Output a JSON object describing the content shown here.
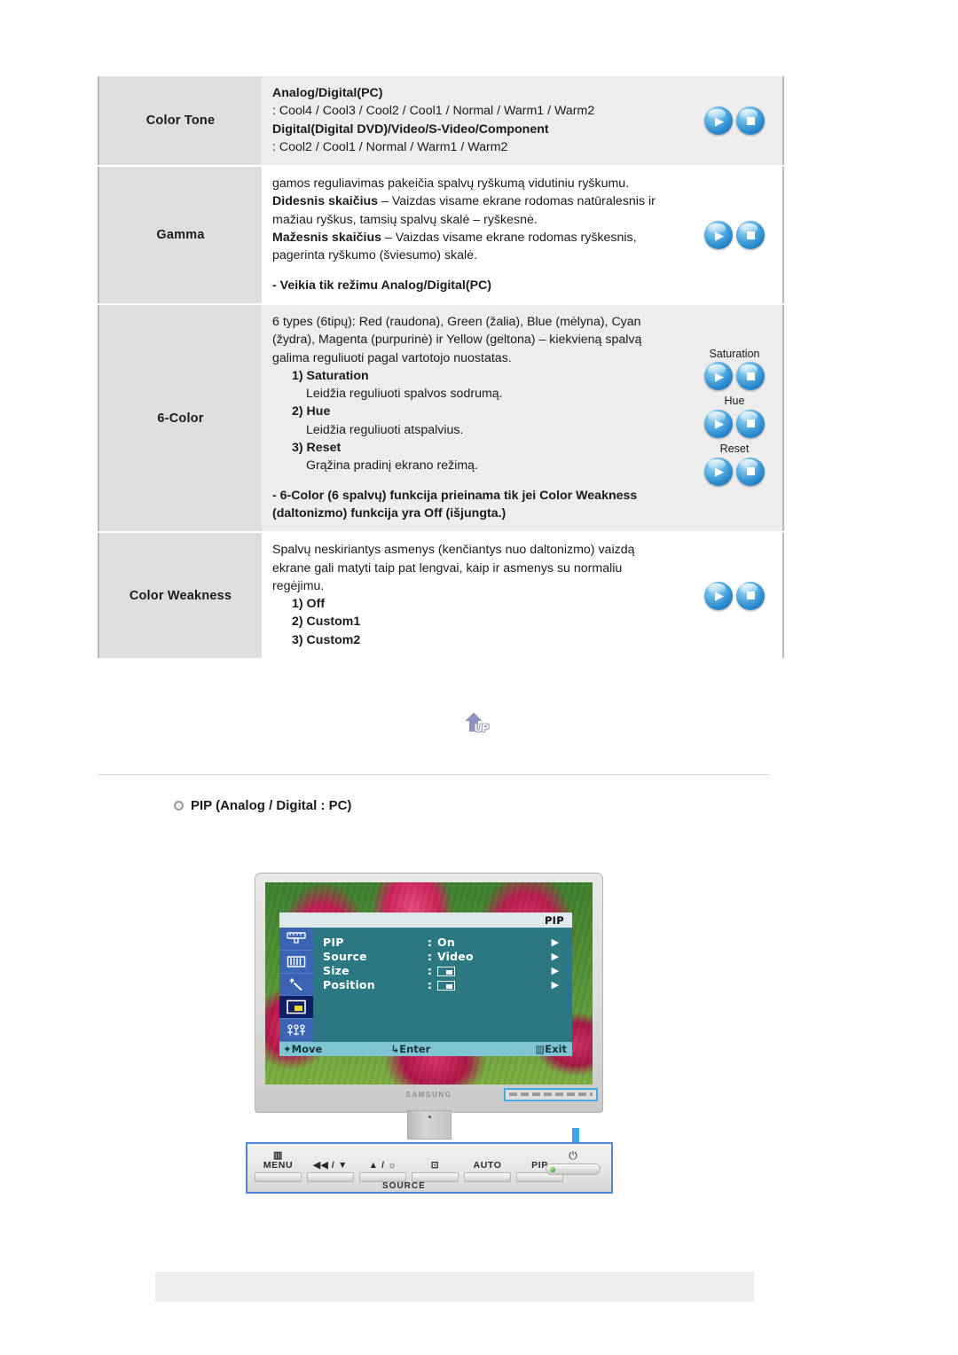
{
  "table": {
    "rows": [
      {
        "label": "Color Tone",
        "blocks": [
          {
            "type": "bold",
            "text": "Analog/Digital(PC)"
          },
          {
            "type": "plain",
            "text": ": Cool4 / Cool3 / Cool2 / Cool1 / Normal / Warm1 / Warm2"
          },
          {
            "type": "bold",
            "text": "Digital(Digital DVD)/Video/S-Video/Component"
          },
          {
            "type": "plain",
            "text": ": Cool2 / Cool1 / Normal / Warm1 / Warm2"
          }
        ],
        "icons": [
          {
            "label": "",
            "buttons": [
              "play-icon",
              "enter-icon"
            ]
          }
        ]
      },
      {
        "label": "Gamma",
        "blocks": [
          {
            "type": "plain",
            "text": "gamos reguliavimas pakeičia spalvų ryškumą vidutiniu ryškumu."
          },
          {
            "type": "mixed",
            "bold": "Didesnis skaičius",
            "rest": " – Vaizdas visame ekrane rodomas natūralesnis ir mažiau ryškus, tamsių spalvų skalė – ryškesnė."
          },
          {
            "type": "mixed",
            "bold": "Mažesnis skaičius",
            "rest": " – Vaizdas visame ekrane rodomas ryškesnis, pagerinta ryškumo (šviesumo) skalė."
          },
          {
            "type": "gap"
          },
          {
            "type": "bold",
            "text": "- Veikia tik režimu Analog/Digital(PC)"
          }
        ],
        "icons": [
          {
            "label": "",
            "buttons": [
              "play-icon",
              "enter-icon"
            ]
          }
        ]
      },
      {
        "label": "6-Color",
        "blocks": [
          {
            "type": "plain",
            "text": "6 types (6tipų): Red (raudona), Green (žalia), Blue (mėlyna), Cyan (žydra), Magenta (purpurinė) ir Yellow (geltona) – kiekvieną spalvą galima reguliuoti pagal vartotojo nuostatas."
          },
          {
            "type": "bold-indent",
            "text": "1) Saturation"
          },
          {
            "type": "plain-indent2",
            "text": "Leidžia reguliuoti spalvos sodrumą."
          },
          {
            "type": "bold-indent",
            "text": "2) Hue"
          },
          {
            "type": "plain-indent2",
            "text": "Leidžia reguliuoti atspalvius."
          },
          {
            "type": "bold-indent",
            "text": "3) Reset"
          },
          {
            "type": "plain-indent2",
            "text": "Grąžina pradinį ekrano režimą."
          },
          {
            "type": "gap"
          },
          {
            "type": "bold",
            "text": "- 6-Color (6 spalvų) funkcija prieinama tik jei Color Weakness (daltonizmo) funkcija yra Off (išjungta.)"
          }
        ],
        "icons": [
          {
            "label": "Saturation",
            "buttons": [
              "play-icon",
              "enter-icon"
            ]
          },
          {
            "label": "Hue",
            "buttons": [
              "play-icon",
              "enter-icon"
            ]
          },
          {
            "label": "Reset",
            "buttons": [
              "play-icon",
              "enter-icon"
            ]
          }
        ]
      },
      {
        "label": "Color Weakness",
        "blocks": [
          {
            "type": "plain",
            "text": "Spalvų neskiriantys asmenys (kenčiantys nuo daltonizmo) vaizdą ekrane gali matyti taip pat lengvai, kaip ir asmenys su normaliu regėjimu."
          },
          {
            "type": "bold-indent",
            "text": "1) Off"
          },
          {
            "type": "bold-indent",
            "text": "2) Custom1"
          },
          {
            "type": "bold-indent",
            "text": "3) Custom2"
          }
        ],
        "icons": [
          {
            "label": "",
            "buttons": [
              "play-icon",
              "enter-icon"
            ]
          }
        ]
      }
    ]
  },
  "up_button": {
    "label": "UP"
  },
  "section": {
    "pip_heading": "PIP (Analog / Digital : PC)"
  },
  "osd": {
    "title": "PIP",
    "rows": [
      {
        "name": "PIP",
        "colon": ":",
        "value": "On",
        "value_type": "text",
        "arrow": "▶"
      },
      {
        "name": "Source",
        "colon": ":",
        "value": "Video",
        "value_type": "text",
        "arrow": "▶"
      },
      {
        "name": "Size",
        "colon": ":",
        "value": "",
        "value_type": "box",
        "arrow": "▶"
      },
      {
        "name": "Position",
        "colon": ":",
        "value": "",
        "value_type": "box",
        "arrow": "▶"
      }
    ],
    "footer": {
      "move": "Move",
      "enter": "Enter",
      "exit": "Exit"
    },
    "sidebar_icons": [
      "brightness-contrast-icon",
      "color-bars-icon",
      "image-magic-icon",
      "pip-icon",
      "setup-icon"
    ]
  },
  "monitor": {
    "brand": "SAMSUNG"
  },
  "control_panel": {
    "buttons": [
      {
        "glyph": "▥",
        "label": "MENU"
      },
      {
        "glyph": "",
        "label": "◀◀ / ▼"
      },
      {
        "glyph": "",
        "label": "▲ / ☼"
      },
      {
        "glyph": "⊡",
        "label": ""
      },
      {
        "glyph": "",
        "label": "AUTO"
      },
      {
        "glyph": "",
        "label": "PIP"
      }
    ],
    "source_label": "SOURCE",
    "power_glyph": "⏻"
  },
  "colors": {
    "table_label_bg": "#dedede",
    "table_desc_bg": "#ededed",
    "osd_body": "#2c7882",
    "osd_sidebar": "#3b64b4",
    "osd_selected": "#101f63",
    "osd_footer": "#7fc4d3",
    "osd_title_bar": "#dfe9ec",
    "accent_blue": "#4f86d8",
    "button_blue": "#2f8fd0"
  }
}
